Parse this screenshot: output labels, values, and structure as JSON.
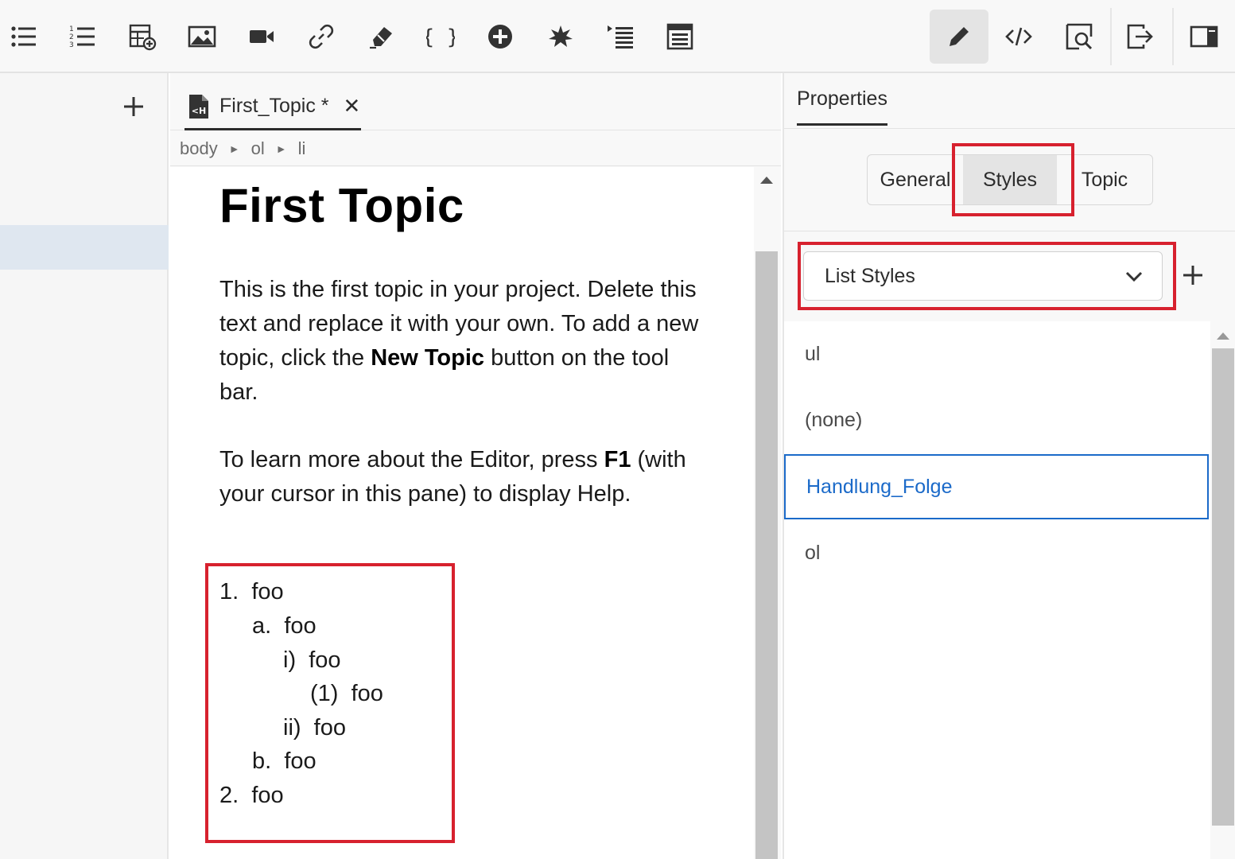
{
  "toolbar": {
    "icons": [
      "bulleted-list-icon",
      "numbered-list-icon",
      "insert-table-icon",
      "insert-image-icon",
      "insert-video-icon",
      "insert-link-icon",
      "eraser-icon",
      "code-braces-icon",
      "add-circle-icon",
      "asterisk-icon",
      "outdent-icon",
      "text-block-icon"
    ],
    "right_icons": [
      "pencil-icon",
      "code-view-icon",
      "preview-icon",
      "export-icon",
      "panel-toggle-icon"
    ]
  },
  "editor": {
    "tab_label": "First_Topic *",
    "tab_close": "✕",
    "breadcrumb": [
      "body",
      "ol",
      "li"
    ],
    "breadcrumb_sep": "►",
    "title": "First Topic",
    "p1_a": "This is the first topic in your project. Delete this text and replace it with your own. To add a new topic, click the ",
    "p1_b": "New Topic",
    "p1_c": " button on the tool bar.",
    "p2_a": "To learn more about the Editor, press ",
    "p2_b": "F1",
    "p2_c": " (with your cursor in this pane) to display Help.",
    "list": [
      {
        "marker": "1.",
        "text": "foo"
      },
      {
        "marker": "a.",
        "text": "foo"
      },
      {
        "marker": "i)",
        "text": "foo"
      },
      {
        "marker": "(1)",
        "text": "foo"
      },
      {
        "marker": "ii)",
        "text": "foo"
      },
      {
        "marker": "b.",
        "text": "foo"
      },
      {
        "marker": "2.",
        "text": "foo"
      }
    ]
  },
  "properties": {
    "title": "Properties",
    "tabs": [
      "General",
      "Styles",
      "Topic"
    ],
    "active_tab": "Styles",
    "dropdown_value": "List Styles",
    "styles": [
      "ul",
      "(none)",
      "Handlung_Folge",
      "ol"
    ],
    "selected_style": "Handlung_Folge"
  },
  "colors": {
    "highlight_red": "#d7212e",
    "selection_blue": "#1b6ac9"
  }
}
